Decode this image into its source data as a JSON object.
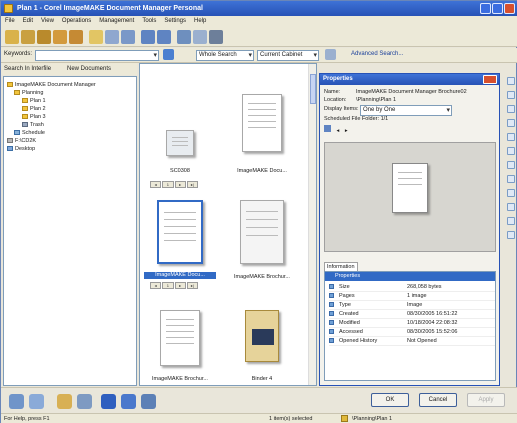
{
  "window": {
    "title": "Plan 1 - Corel ImageMAKE Document Manager Personal"
  },
  "menu": [
    "File",
    "Edit",
    "View",
    "Operations",
    "Management",
    "Tools",
    "Settings",
    "Help"
  ],
  "address": {
    "keywords_label": "Keywords:",
    "keywords_value": "",
    "search_mode": "Whole Search",
    "scope": "Current Cabinet",
    "advanced_search_label": "Advanced Search..."
  },
  "search_row": {
    "search_in_label": "Search In Interfile",
    "new_documents_label": "New Documents"
  },
  "tree": {
    "items": [
      {
        "label": "ImageMAKE Document Manager",
        "level": 0
      },
      {
        "label": "Planning",
        "level": 1
      },
      {
        "label": "Plan 1",
        "level": 2
      },
      {
        "label": "Plan 2",
        "level": 2
      },
      {
        "label": "Plan 3",
        "level": 2
      },
      {
        "label": "Trash",
        "level": 2
      },
      {
        "label": "Schedule",
        "level": 1
      },
      {
        "label": "F:\\CD2K",
        "level": 0
      },
      {
        "label": "Desktop",
        "level": 0
      }
    ]
  },
  "thumbnails": [
    {
      "caption": "SC0308",
      "selected": false
    },
    {
      "caption": "ImageMAKE Docu...",
      "selected": false
    },
    {
      "caption": "ImageMAKE Docu...",
      "selected": true
    },
    {
      "caption": "ImageMAKE Brochur...",
      "selected": false
    },
    {
      "caption": "ImageMAKE Brochur...",
      "selected": false
    },
    {
      "caption": "Binder 4",
      "selected": false
    }
  ],
  "pager": [
    "◂",
    "1",
    "▸",
    "▸|"
  ],
  "properties": {
    "title": "Properties",
    "name_label": "Name:",
    "name_value": "ImageMAKE Document Manager Brochure02",
    "location_label": "Location:",
    "location_value": "\\Planning\\Plan 1",
    "display_label": "Display Items:",
    "display_value": "One by One",
    "files_label": "Scheduled File Folder:",
    "files_value": "1/1",
    "info_tab": "Information",
    "info_header": "Properties",
    "info_rows": [
      {
        "key": "Size",
        "value": "268,058 bytes"
      },
      {
        "key": "Pages",
        "value": "1 image"
      },
      {
        "key": "Type",
        "value": "Image"
      },
      {
        "key": "Created",
        "value": "08/30/2005 16:51:22"
      },
      {
        "key": "Modified",
        "value": "10/18/2004 22:08:32"
      },
      {
        "key": "Accessed",
        "value": "08/30/2005 15:52:06"
      },
      {
        "key": "Opened History",
        "value": "Not Opened"
      }
    ]
  },
  "buttons": {
    "ok": "OK",
    "cancel": "Cancel",
    "apply": "Apply"
  },
  "status": {
    "help": "For Help, press F1",
    "selected": "1 item(s) selected",
    "location": "\\Planning\\Plan 1"
  }
}
